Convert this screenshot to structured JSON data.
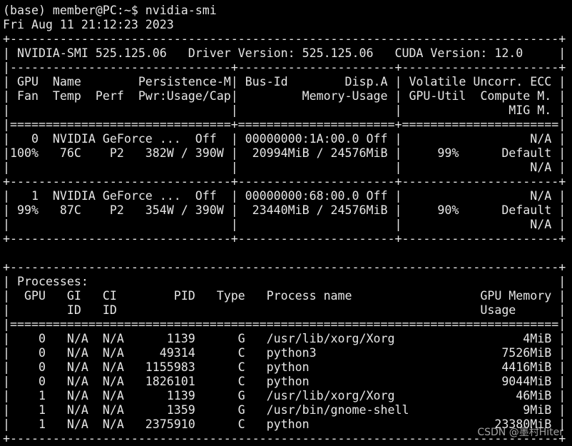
{
  "terminal": {
    "lines": [
      "(base) member@PC:~$ nvidia-smi",
      "Fri Aug 11 21:12:23 2023",
      "+-----------------------------------------------------------------------------+",
      "| NVIDIA-SMI 525.125.06   Driver Version: 525.125.06   CUDA Version: 12.0     |",
      "|-------------------------------+----------------------+----------------------+",
      "| GPU  Name        Persistence-M| Bus-Id        Disp.A | Volatile Uncorr. ECC |",
      "| Fan  Temp  Perf  Pwr:Usage/Cap|         Memory-Usage | GPU-Util  Compute M. |",
      "|                               |                      |               MIG M. |",
      "|===============================+======================+======================|",
      "|   0  NVIDIA GeForce ...  Off  | 00000000:1A:00.0 Off |                  N/A |",
      "|100%   76C    P2   382W / 390W |  20994MiB / 24576MiB |     99%      Default |",
      "|                               |                      |                  N/A |",
      "+-------------------------------+----------------------+----------------------+",
      "|   1  NVIDIA GeForce ...  Off  | 00000000:68:00.0 Off |                  N/A |",
      "| 99%   87C    P2   354W / 390W |  23440MiB / 24576MiB |     90%      Default |",
      "|                               |                      |                  N/A |",
      "+-------------------------------+----------------------+----------------------+",
      "",
      "+-----------------------------------------------------------------------------+",
      "| Processes:                                                                  |",
      "|  GPU   GI   CI        PID   Type   Process name                  GPU Memory |",
      "|        ID   ID                                                   Usage      |",
      "|=============================================================================|",
      "|    0   N/A  N/A      1139      G   /usr/lib/xorg/Xorg                  4MiB |",
      "|    0   N/A  N/A     49314      C   python3                          7526MiB |",
      "|    0   N/A  N/A   1155983      C   python                           4416MiB |",
      "|    0   N/A  N/A   1826101      C   python                           9044MiB |",
      "|    1   N/A  N/A      1139      G   /usr/lib/xorg/Xorg                 46MiB |",
      "|    1   N/A  N/A      1359      G   /usr/bin/gnome-shell                9MiB |",
      "|    1   N/A  N/A   2375910      C   python                          23380MiB |",
      "+-----------------------------------------------------------------------------+"
    ]
  },
  "watermark": "CSDN @墨村Hiter",
  "colors": {
    "background": "#000000",
    "foreground": "#e6e6e6"
  }
}
